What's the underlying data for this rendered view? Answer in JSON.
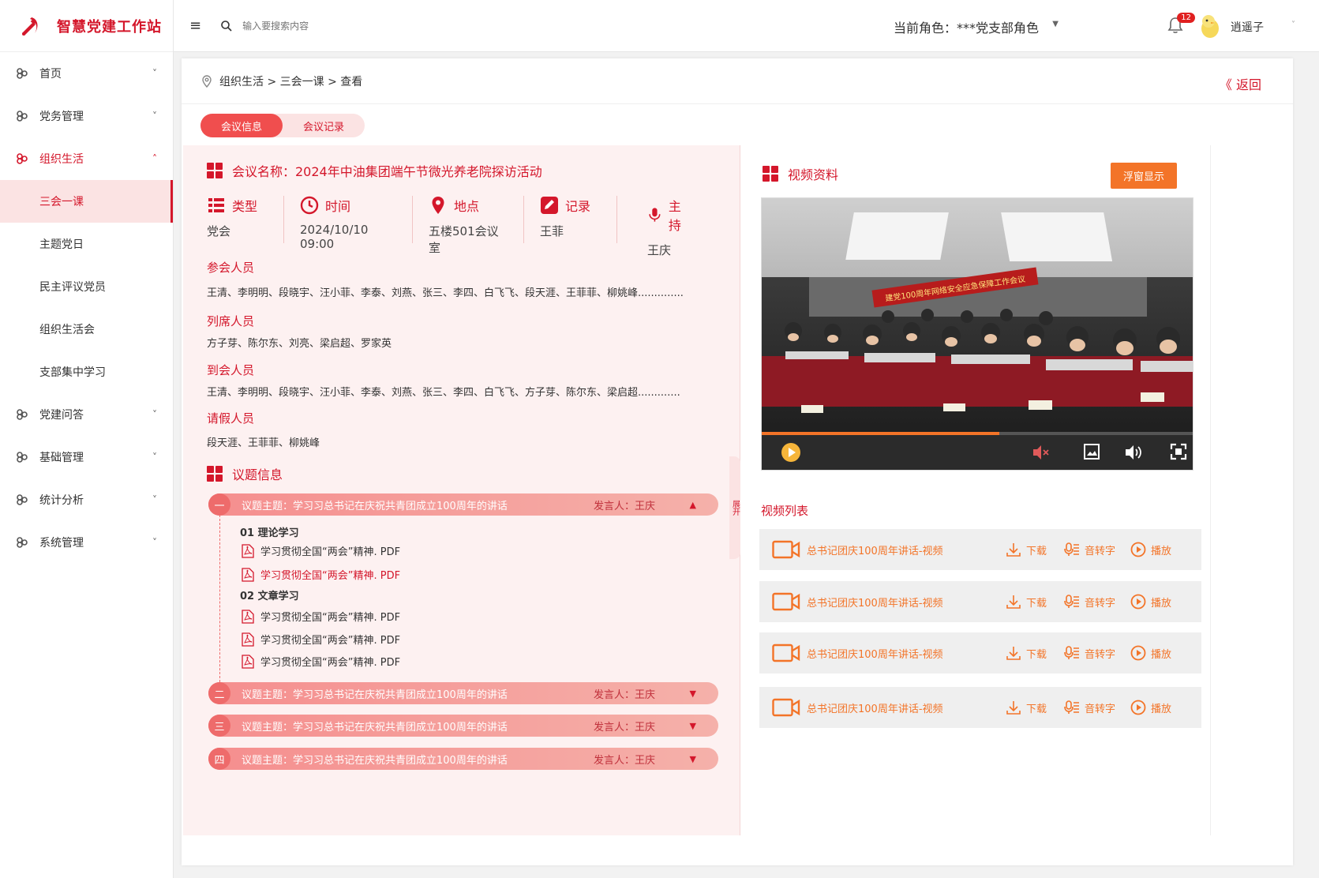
{
  "app": {
    "title": "智慧党建工作站"
  },
  "sidebar": {
    "items": [
      {
        "label": "首页",
        "chevron": "˅"
      },
      {
        "label": "党务管理",
        "chevron": "˅"
      },
      {
        "label": "组织生活",
        "chevron": "˄"
      },
      {
        "label": "党建问答",
        "chevron": "˅"
      },
      {
        "label": "基础管理",
        "chevron": "˅"
      },
      {
        "label": "统计分析",
        "chevron": "˅"
      },
      {
        "label": "系统管理",
        "chevron": "˅"
      }
    ],
    "sub_items": [
      "三会一课",
      "主题党日",
      "民主评议党员",
      "组织生活会",
      "支部集中学习"
    ]
  },
  "header": {
    "menu_icon": "≡",
    "search_placeholder": "输入要搜索内容",
    "role": "当前角色：***党支部角色",
    "notification_count": "12",
    "username": "逍遥子"
  },
  "breadcrumb": {
    "path": "组织生活 > 三会一课 > 查看",
    "back": "《 返回"
  },
  "tabs": [
    "会议信息",
    "会议记录"
  ],
  "meeting": {
    "name": "会议名称：2024年中油集团端午节微光养老院探访活动",
    "meta": [
      {
        "label": "类型",
        "value": "党会"
      },
      {
        "label": "时间",
        "value": "2024/10/10 09:00"
      },
      {
        "label": "地点",
        "value": "五楼501会议室"
      },
      {
        "label": "记录",
        "value": "王菲"
      },
      {
        "label": "主持",
        "value": "王庆"
      }
    ],
    "attendees_title": "参会人员",
    "attendees": "王清、李明明、段晓宇、汪小菲、李泰、刘燕、张三、李四、白飞飞、段天涯、王菲菲、柳姚峰..............",
    "observers_title": "列席人员",
    "observers": "方子芽、陈尔东、刘亮、梁启超、罗家英",
    "present_title": "到会人员",
    "present": "王清、李明明、段晓宇、汪小菲、李泰、刘燕、张三、李四、白飞飞、方子芽、陈尔东、梁启超.............",
    "leave_title": "请假人员",
    "leave": "段天涯、王菲菲、柳姚峰"
  },
  "topics": {
    "title": "议题信息",
    "items": [
      {
        "num": "一",
        "title": "议题主题：学习习总书记在庆祝共青团成立100周年的讲话",
        "speaker": "发言人：王庆",
        "arrow": "▲"
      },
      {
        "num": "二",
        "title": "议题主题：学习习总书记在庆祝共青团成立100周年的讲话",
        "speaker": "发言人：王庆",
        "arrow": "▼"
      },
      {
        "num": "三",
        "title": "议题主题：学习习总书记在庆祝共青团成立100周年的讲话",
        "speaker": "发言人：王庆",
        "arrow": "▼"
      },
      {
        "num": "四",
        "title": "议题主题：学习习总书记在庆祝共青团成立100周年的讲话",
        "speaker": "发言人：王庆",
        "arrow": "▼"
      }
    ],
    "categories": [
      {
        "label": "01 理论学习",
        "files": [
          "学习贯彻全国“两会”精神. PDF",
          "学习贯彻全国“两会”精神. PDF"
        ]
      },
      {
        "label": "02 文章学习",
        "files": [
          "学习贯彻全国“两会”精神. PDF",
          "学习贯彻全国“两会”精神. PDF",
          "学习贯彻全国“两会”精神. PDF"
        ]
      }
    ],
    "expand_label": "展开"
  },
  "video": {
    "title": "视频资料",
    "float_button": "浮窗显示",
    "banner": "建党100周年网络安全应急保障工作会议",
    "progress": 0.55,
    "list_title": "视频列表",
    "list": [
      {
        "name": "总书记团庆100周年讲话-视频",
        "download": "下载",
        "transcribe": "音转字",
        "play": "播放"
      },
      {
        "name": "总书记团庆100周年讲话-视频",
        "download": "下载",
        "transcribe": "音转字",
        "play": "播放"
      },
      {
        "name": "总书记团庆100周年讲话-视频",
        "download": "下载",
        "transcribe": "音转字",
        "play": "播放"
      },
      {
        "name": "总书记团庆100周年讲话-视频",
        "download": "下载",
        "transcribe": "音转字",
        "play": "播放"
      }
    ]
  },
  "colors": {
    "accent": "#d4172b",
    "orange": "#f37428",
    "panel_pink": "#fdf1f1"
  }
}
